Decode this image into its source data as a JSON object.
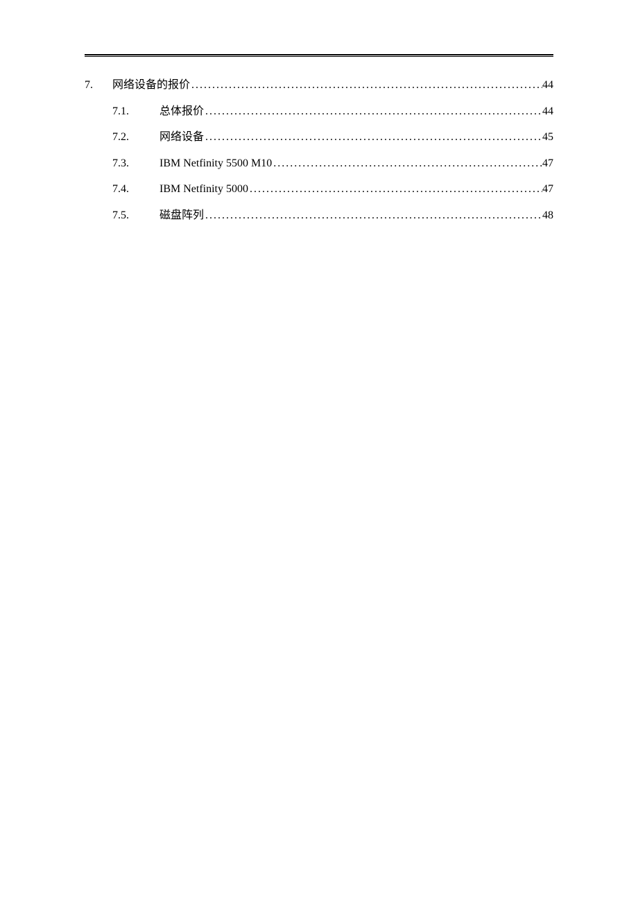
{
  "toc": {
    "items": [
      {
        "level": 1,
        "number": "7.",
        "title": "网络设备的报价",
        "page": "44"
      },
      {
        "level": 2,
        "number": "7.1.",
        "title": "总体报价",
        "page": "44"
      },
      {
        "level": 2,
        "number": "7.2.",
        "title": "网络设备",
        "page": "45"
      },
      {
        "level": 2,
        "number": "7.3.",
        "title": "IBM Netfinity 5500 M10",
        "page": "47"
      },
      {
        "level": 2,
        "number": "7.4.",
        "title": "IBM Netfinity 5000",
        "page": "47"
      },
      {
        "level": 2,
        "number": "7.5.",
        "title": "磁盘阵列",
        "page": "48"
      }
    ]
  }
}
